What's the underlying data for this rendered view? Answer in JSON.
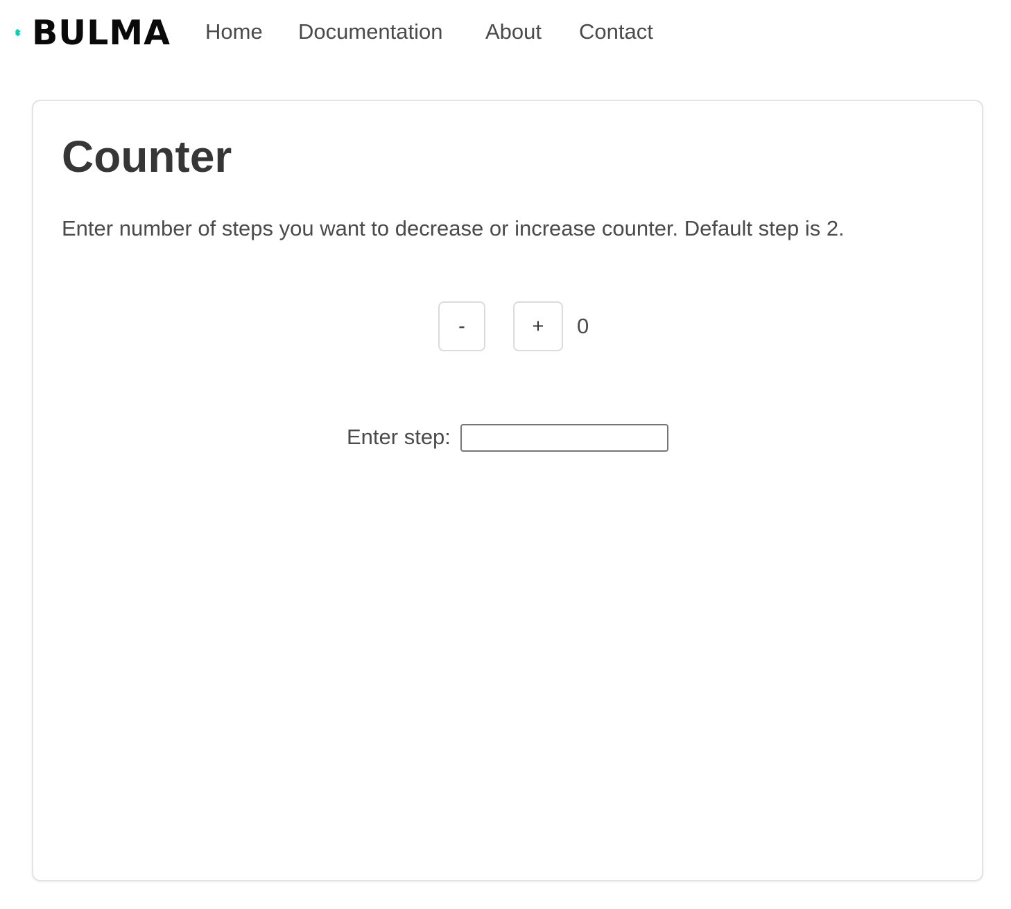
{
  "brand": {
    "name": "BULMA",
    "accent_color": "#00d1b2",
    "icon": "bulma-logo-icon"
  },
  "nav": {
    "items": [
      {
        "label": "Home"
      },
      {
        "label": "Documentation"
      },
      {
        "label": "About"
      },
      {
        "label": "Contact"
      }
    ]
  },
  "counter": {
    "title": "Counter",
    "description": "Enter number of steps you want to decrease or increase counter. Default step is 2.",
    "decrement_label": "-",
    "increment_label": "+",
    "value": "0",
    "step_label": "Enter step:",
    "step_value": ""
  }
}
